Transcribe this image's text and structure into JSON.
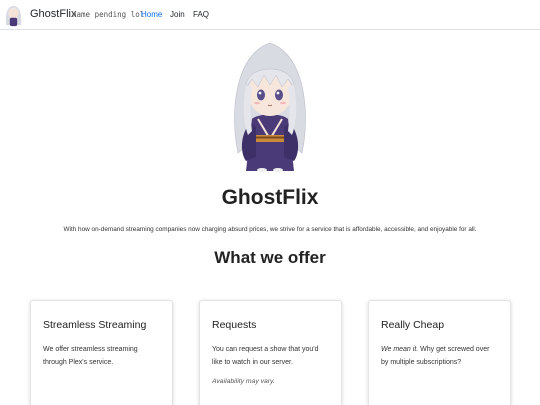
{
  "nav": {
    "brand": "GhostFlix",
    "tagline": "name pending lol",
    "links": [
      {
        "label": "Home",
        "active": true
      },
      {
        "label": "Join",
        "active": false
      },
      {
        "label": "FAQ",
        "active": false
      }
    ]
  },
  "hero": {
    "title": "GhostFlix",
    "description": "With how on-demand streaming companies now charging absurd prices, we strive for a service that is affordable, accessible, and enjoyable for all.",
    "offer_heading": "What we offer"
  },
  "cards": [
    {
      "title": "Streamless Streaming",
      "text": "We offer streamless streaming through Plex's service."
    },
    {
      "title": "Requests",
      "text": "You can request a show that you'd like to watch in our server.",
      "note": "Availability may vary."
    },
    {
      "title": "Really Cheap",
      "text_em": "We mean it.",
      "text": " Why get screwed over by multiple subscriptions?"
    }
  ],
  "colors": {
    "link_active": "#0d6efd",
    "hair": "#d9dbe2",
    "robe": "#4a3a78",
    "sash": "#c98a3a"
  }
}
